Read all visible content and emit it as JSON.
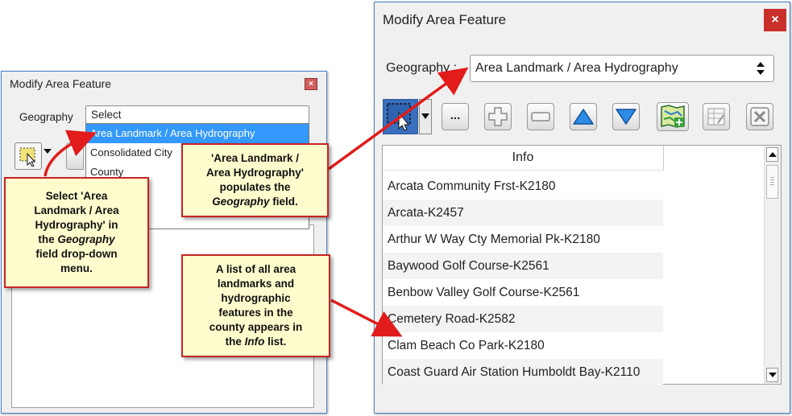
{
  "small_window": {
    "title": "Modify Area Feature",
    "close_icon": "close-icon",
    "geography_label": "Geography",
    "geography_value": "Select",
    "dropdown_options": [
      "Area Landmark / Area Hydrography",
      "Consolidated City",
      "County"
    ],
    "selected_option_index": 0
  },
  "large_window": {
    "title": "Modify Area Feature",
    "close_label": "×",
    "geography_label": "Geography :",
    "geography_value": "Area Landmark / Area Hydrography",
    "toolbar": {
      "select_tool_icon": "selection-rectangle-icon",
      "more_label": "...",
      "add_icon": "plus-icon",
      "remove_icon": "minus-icon",
      "up_icon": "up-triangle-icon",
      "down_icon": "down-triangle-icon",
      "map_icon": "map-add-icon",
      "table_icon": "table-edit-icon",
      "delete_icon": "x-icon"
    },
    "list_header": "Info",
    "list_items": [
      "Arcata Community Frst-K2180",
      "Arcata-K2457",
      "Arthur W Way Cty Memorial Pk-K2180",
      "Baywood Golf Course-K2561",
      "Benbow Valley Golf Course-K2561",
      "Cemetery Road-K2582",
      "Clam Beach Co Park-K2180",
      "Coast Guard Air Station Humboldt Bay-K2110"
    ]
  },
  "callouts": {
    "select_callout": {
      "line1": "Select 'Area",
      "line2": "Landmark / Area",
      "line3": "Hydrography' in",
      "line4_pre": "the ",
      "line4_em": "Geography",
      "line5": "field drop-down",
      "line6": "menu."
    },
    "populates_callout": {
      "line1": "'Area Landmark /",
      "line2": "Area Hydrography'",
      "line3": "populates the",
      "line4_em": "Geography",
      "line4_post": " field."
    },
    "list_callout": {
      "line1": "A list of all area",
      "line2": "landmarks and",
      "line3": "hydrographic",
      "line4": "features in the",
      "line5": "county appears in",
      "line6_pre": "the ",
      "line6_em": "Info",
      "line6_post": " list."
    }
  },
  "colors": {
    "callout_border": "#c62424",
    "callout_fill": "#fefccd",
    "arrow": "#e21b1b",
    "selection_highlight": "#3399ff",
    "close_button": "#c9302c"
  }
}
